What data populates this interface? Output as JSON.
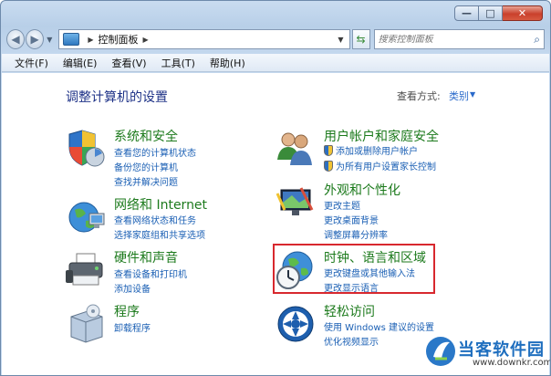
{
  "window": {
    "caption_min": "—",
    "caption_max": "□",
    "caption_close": "✕"
  },
  "address": {
    "path": [
      "控制面板"
    ],
    "search_placeholder": "搜索控制面板"
  },
  "menu": [
    "文件(F)",
    "编辑(E)",
    "查看(V)",
    "工具(T)",
    "帮助(H)"
  ],
  "content": {
    "title": "调整计算机的设置",
    "view_by_label": "查看方式:",
    "view_by_value": "类别"
  },
  "categories": {
    "system": {
      "title": "系统和安全",
      "links": [
        "查看您的计算机状态",
        "备份您的计算机",
        "查找并解决问题"
      ]
    },
    "network": {
      "title": "网络和 Internet",
      "links": [
        "查看网络状态和任务",
        "选择家庭组和共享选项"
      ]
    },
    "hardware": {
      "title": "硬件和声音",
      "links": [
        "查看设备和打印机",
        "添加设备"
      ]
    },
    "programs": {
      "title": "程序",
      "links": [
        "卸载程序"
      ]
    },
    "user": {
      "title": "用户帐户和家庭安全",
      "links": [
        "添加或删除用户帐户",
        "为所有用户设置家长控制"
      ]
    },
    "appearance": {
      "title": "外观和个性化",
      "links": [
        "更改主题",
        "更改桌面背景",
        "调整屏幕分辨率"
      ]
    },
    "clock": {
      "title": "时钟、语言和区域",
      "links": [
        "更改键盘或其他输入法",
        "更改显示语言"
      ]
    },
    "ease": {
      "title": "轻松访问",
      "links": [
        "使用 Windows 建议的设置",
        "优化视频显示"
      ]
    }
  },
  "watermark": {
    "name": "当客软件园",
    "url": "www.downkr.com"
  },
  "colors": {
    "title_blue": "#1e3287",
    "category_green": "#1c7a1c",
    "link_blue": "#1a5fb4",
    "highlight_red": "#d8282e"
  }
}
